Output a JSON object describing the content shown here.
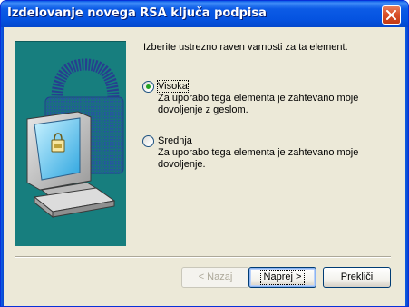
{
  "window": {
    "title": "Izdelovanje novega RSA ključa podpisa"
  },
  "prompt": "Izberite ustrezno raven varnosti za ta element.",
  "options": [
    {
      "label": "Visoka",
      "description": "Za uporabo tega elementa je zahtevano moje dovoljenje z geslom.",
      "selected": true
    },
    {
      "label": "Srednja",
      "description": "Za uporabo tega elementa je zahtevano moje dovoljenje.",
      "selected": false
    }
  ],
  "buttons": {
    "back": "< Nazaj",
    "next": "Naprej >",
    "cancel": "Prekliči"
  },
  "colors": {
    "titlebar": "#0553e0",
    "panel": "#ece9d8",
    "art_background": "#177e7e",
    "radio_selected": "#21a121"
  },
  "icons": {
    "art": "computer-with-padlock",
    "close": "close-icon"
  }
}
